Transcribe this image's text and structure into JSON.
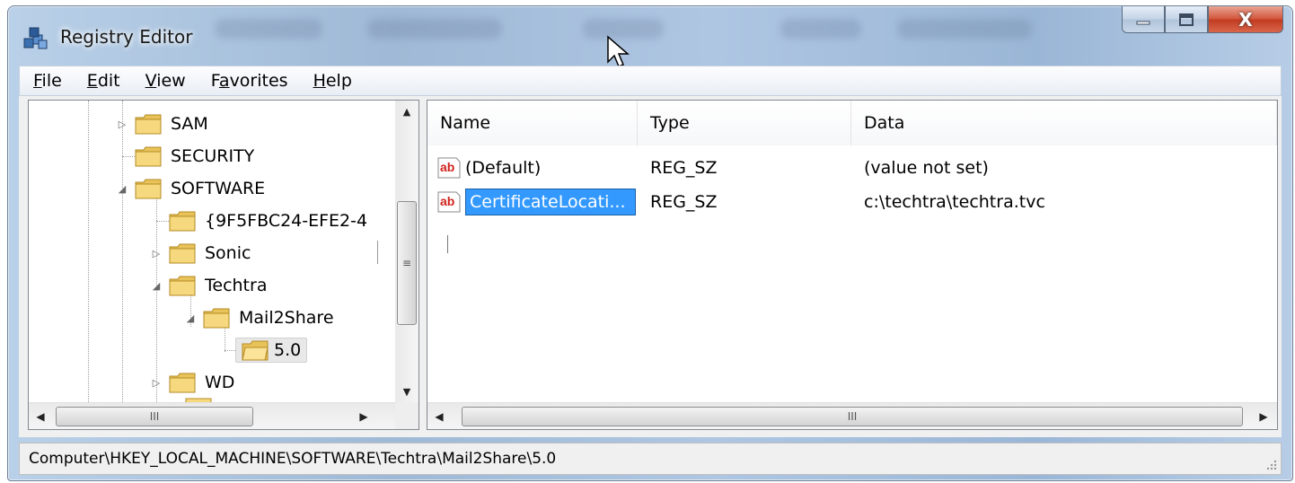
{
  "window": {
    "title": "Registry Editor",
    "buttons": {
      "minimize_icon": "minimize-icon",
      "maximize_icon": "maximize-icon",
      "close_label": "X"
    }
  },
  "menu": [
    {
      "key": "F",
      "rest": "ile"
    },
    {
      "key": "E",
      "rest": "dit"
    },
    {
      "key": "V",
      "rest": "iew"
    },
    {
      "pre": "F",
      "key": "a",
      "rest": "vorites"
    },
    {
      "key": "H",
      "rest": "elp"
    }
  ],
  "tree": {
    "items": [
      {
        "label": "SAM",
        "expander": "collapsed"
      },
      {
        "label": "SECURITY",
        "expander": "none"
      },
      {
        "label": "SOFTWARE",
        "expander": "expanded"
      },
      {
        "label": "{9F5FBC24-EFE2-4",
        "expander": "none"
      },
      {
        "label": "Sonic",
        "expander": "collapsed"
      },
      {
        "label": "Techtra",
        "expander": "expanded"
      },
      {
        "label": "Mail2Share",
        "expander": "expanded"
      },
      {
        "label": "5.0",
        "expander": "none",
        "selected": true
      },
      {
        "label": "WD",
        "expander": "collapsed"
      }
    ],
    "scroll_up": "▲",
    "scroll_down": "▼",
    "scroll_left": "◀",
    "scroll_right": "▶",
    "thumb_grip": "≡",
    "hthumb_grip": "III"
  },
  "list": {
    "columns": [
      "Name",
      "Type",
      "Data"
    ],
    "rows": [
      {
        "icon": "ab",
        "name": "(Default)",
        "type": "REG_SZ",
        "data": "(value not set)",
        "selected": false
      },
      {
        "icon": "ab",
        "name": "CertificateLocati...",
        "type": "REG_SZ",
        "data": "c:\\techtra\\techtra.tvc",
        "selected": true
      }
    ],
    "hthumb_grip": "III"
  },
  "status": {
    "path": "Computer\\HKEY_LOCAL_MACHINE\\SOFTWARE\\Techtra\\Mail2Share\\5.0"
  }
}
